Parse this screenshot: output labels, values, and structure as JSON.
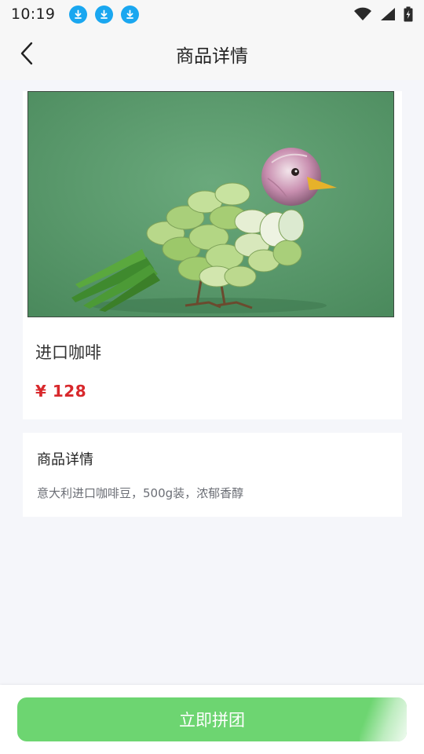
{
  "status_bar": {
    "time": "10:19",
    "notification_icons": [
      "download-icon",
      "download-icon",
      "download-icon"
    ],
    "right_icons": [
      "wifi-icon",
      "signal-icon",
      "battery-charging-icon"
    ]
  },
  "header": {
    "title": "商品详情",
    "back_icon": "chevron-left-icon"
  },
  "product": {
    "name": "进口咖啡",
    "price": "¥ 128",
    "image_alt": "garlic-and-scallion bird sculpture"
  },
  "details": {
    "title": "商品详情",
    "description": "意大利进口咖啡豆，500g装，浓郁香醇"
  },
  "bottom": {
    "button_label": "立即拼团"
  },
  "colors": {
    "page_bg": "#f5f6fa",
    "card_bg": "#ffffff",
    "price": "#d8282c",
    "button": "#6dd571",
    "download_badge": "#1aa7f0"
  }
}
